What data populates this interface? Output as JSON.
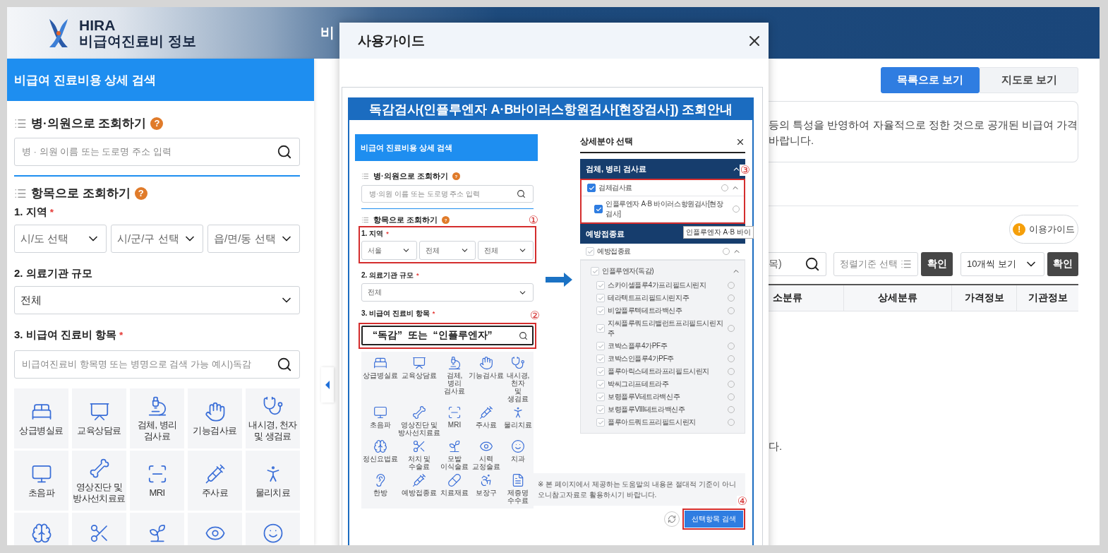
{
  "page_header": {
    "title": "HIRA",
    "subtitle": "비급여진료비 정보",
    "nav_label": "비"
  },
  "sidebar": {
    "title": "비급여 진료비용 상세 검색",
    "hospital_search": {
      "heading": "병·의원으로 조회하기",
      "help": "?",
      "placeholder": "병 · 의원 이름 또는 도로명 주소 입력"
    },
    "item_search": {
      "heading": "항목으로 조회하기",
      "help": "?"
    },
    "region": {
      "label": "1. 지역",
      "required": "*",
      "selects": [
        "시/도 선택",
        "시/군/구 선택",
        "읍/면/동 선택"
      ]
    },
    "scale": {
      "label": "2. 의료기관 규모",
      "value": "전체"
    },
    "items": {
      "label": "3. 비급여 진료비 항목",
      "required": "*",
      "placeholder": "비급여진료비 항목명 또는 병명으로 검색 가능 예시)독감"
    },
    "categories": [
      {
        "kind": "labeled",
        "label": "상급병실료"
      },
      {
        "kind": "labeled",
        "label": "교육상담료"
      },
      {
        "kind": "labeled",
        "label": "검체, 병리\n검사료"
      },
      {
        "kind": "labeled",
        "label": "기능검사료"
      },
      {
        "kind": "labeled",
        "label": "내시경, 천자\n및 생검료"
      },
      {
        "kind": "labeled",
        "label": "초음파"
      },
      {
        "kind": "labeled",
        "label": "영상진단 및\n방사선치료료"
      },
      {
        "kind": "labeled",
        "label": "MRI"
      },
      {
        "kind": "labeled",
        "label": "주사료"
      },
      {
        "kind": "labeled",
        "label": "물리치료"
      },
      {
        "kind": "icon"
      },
      {
        "kind": "icon"
      },
      {
        "kind": "icon"
      },
      {
        "kind": "icon"
      },
      {
        "kind": "icon"
      }
    ]
  },
  "main": {
    "view_tabs": [
      {
        "label": "목록으로 보기",
        "selected": true
      },
      {
        "label": "지도로 보기",
        "selected": false
      }
    ],
    "notice_lines": [
      "등의 특성을 반영하여 자율적으로 정한 것으로 공개된 비급여 가격",
      "바랍니다."
    ],
    "guide_button": {
      "icon": "!",
      "label": "이용가이드"
    },
    "search_text": "목)",
    "sort_placeholder": "정렬기준 선택",
    "confirm_buttons": [
      "확인",
      "확인"
    ],
    "page_size": "10개씩 보기",
    "columns": [
      "소분류",
      "상세분류",
      "가격정보",
      "기관정보"
    ],
    "empty_text": "다."
  },
  "modal": {
    "title": "사용가이드",
    "guide": {
      "title": "독감검사(인플루엔자 A·B바이러스항원검사[현장검사]) 조회안내",
      "markers": [
        "①",
        "②",
        "③",
        "④"
      ],
      "mini_sidebar": {
        "title": "비급여 진료비용 상세 검색",
        "hospital_heading": "병·의원으로 조회하기",
        "help": "?",
        "placeholder": "병·의원 이름 또는 도로명 주소 입력",
        "item_heading": "항목으로 조회하기",
        "region_label": "1. 지역",
        "required": "*",
        "selects": [
          "서울",
          "전체",
          "전체"
        ],
        "scale_label": "2. 의료기관 규모",
        "scale_value": "전체",
        "items_label": "3. 비급여 진료비 항목",
        "search_text": "“독감”  또는  “인플루엔자”",
        "categories": [
          "상급병실료",
          "교육상담료",
          "검체, 병리\n검사료",
          "기능검사료",
          "내시경, 천자\n및 생검료",
          "초음파",
          "영상진단 및\n방사선치료료",
          "MRI",
          "주사료",
          "물리치료",
          "정신요법료",
          "처치 및 수술료",
          "모발 이식술료",
          "시력 교정술료",
          "치과",
          "한방",
          "예방접종료",
          "치료재료",
          "보장구",
          "제증명 수수료"
        ]
      },
      "detail": {
        "title": "상세분야 선택",
        "tooltip": "인플루엔자 A·B 바이",
        "sections": [
          {
            "title": "검체, 병리 검사료",
            "rows": [
              {
                "label": "검체검사료",
                "checked": true,
                "children": [
                  {
                    "label": "인플루엔자 A·B 바이러스항원검사[현장검사]",
                    "checked": true
                  }
                ]
              }
            ]
          },
          {
            "title": "예방접종료",
            "rows": [
              {
                "label": "예방접종료",
                "checked": false,
                "children": [
                  {
                    "label": "인플루엔자(독감)",
                    "checked": false,
                    "children": [
                      {
                        "label": "스카이셀플루4가프리필드시린지",
                        "checked": false
                      },
                      {
                        "label": "테라텍트프리필드시린지주",
                        "checked": false
                      },
                      {
                        "label": "비알플루텍테트라백신주",
                        "checked": false
                      },
                      {
                        "label": "지씨플루쿼드리밸런트프리필드시린지주",
                        "checked": false
                      },
                      {
                        "label": "코박스플루4가PF주",
                        "checked": false
                      },
                      {
                        "label": "코박스인플루4가PF주",
                        "checked": false
                      },
                      {
                        "label": "플루아릭스테트라프리필드시린지",
                        "checked": false
                      },
                      {
                        "label": "박씨그리프테트라주",
                        "checked": false
                      },
                      {
                        "label": "보령플루V테트라백신주",
                        "checked": false
                      },
                      {
                        "label": "보령플루VIII테트라백신주",
                        "checked": false
                      },
                      {
                        "label": "플루아드쿼드프리필드시린지",
                        "checked": false
                      }
                    ]
                  }
                ]
              }
            ]
          }
        ]
      },
      "notice": "※ 본 페이지에서 제공하는 도움말의 내용은 절대적 기준이 아니오니참고자료로 활용하시기 바랍니다.",
      "search_button": "선택항목 검색"
    }
  }
}
